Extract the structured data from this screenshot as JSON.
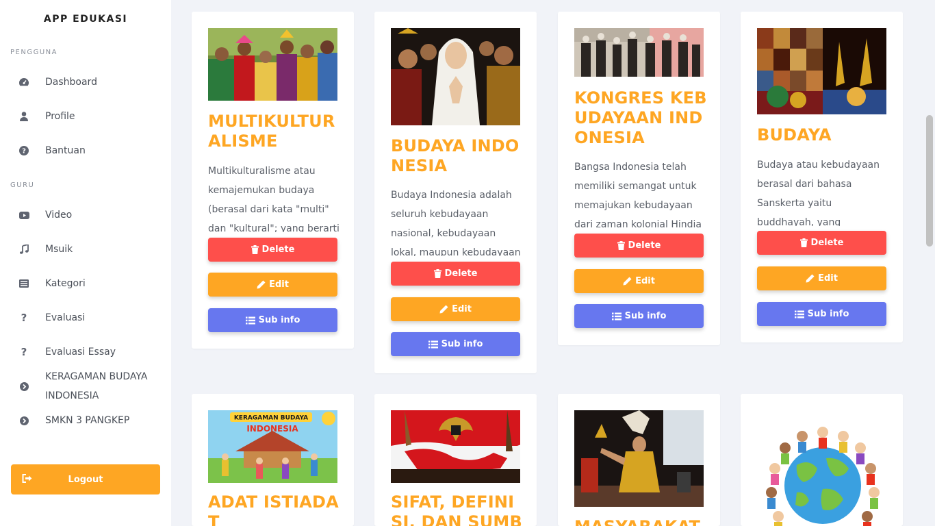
{
  "app": {
    "brand": "APP EDUKASI"
  },
  "sidebar": {
    "section_pengguna": "PENGGUNA",
    "section_guru": "GURU",
    "items": [
      {
        "label": "Dashboard",
        "icon": "dashboard-icon"
      },
      {
        "label": "Profile",
        "icon": "user-icon"
      },
      {
        "label": "Bantuan",
        "icon": "question-circle-icon"
      },
      {
        "label": "Video",
        "icon": "youtube-icon"
      },
      {
        "label": "Msuik",
        "icon": "music-icon"
      },
      {
        "label": "Kategori",
        "icon": "list-alt-icon"
      },
      {
        "label": "Evaluasi",
        "icon": "question-icon"
      },
      {
        "label": "Evaluasi Essay",
        "icon": "question-icon"
      },
      {
        "label": "KERAGAMAN BUDAYA INDONESIA",
        "icon": "chevron-circle-right-icon"
      },
      {
        "label": "SMKN 3 PANGKEP",
        "icon": "chevron-circle-right-icon"
      }
    ],
    "logout_label": "Logout"
  },
  "buttons": {
    "delete": "Delete",
    "edit": "Edit",
    "sub_info": "Sub info"
  },
  "cards": [
    {
      "title": "MULTIKULTURALISME",
      "desc": "Multikulturalisme atau kemajemukan budaya (berasal dari kata \"multi\" dan \"kultural\"; yang berarti"
    },
    {
      "title": "BUDAYA INDONESIA",
      "desc": "Budaya Indonesia adalah seluruh kebudayaan nasional, kebudayaan lokal, maupun kebudayaan asal asing yang"
    },
    {
      "title": "KONGRES KEBUDAYAAN INDONESIA",
      "desc": "Bangsa Indonesia telah memiliki semangat untuk memajukan kebudayaan dari zaman kolonial Hindia"
    },
    {
      "title": "BUDAYA",
      "desc": "Budaya atau kebudayaan berasal dari bahasa Sanskerta yaitu buddhayah, yang merupakan bentuk jamak dari"
    },
    {
      "title": "ADAT ISTIADAT",
      "desc": ""
    },
    {
      "title": "SIFAT, DEFINISI, DAN SUMBER",
      "desc": ""
    },
    {
      "title": "MASYARAKAT",
      "desc": ""
    },
    {
      "title": "",
      "desc": ""
    }
  ],
  "banner_text": {
    "line1": "KERAGAMAN BUDAYA",
    "line2": "INDONESIA"
  },
  "colors": {
    "accent": "#fea623",
    "delete": "#fe4f4b",
    "info": "#6777ef"
  }
}
